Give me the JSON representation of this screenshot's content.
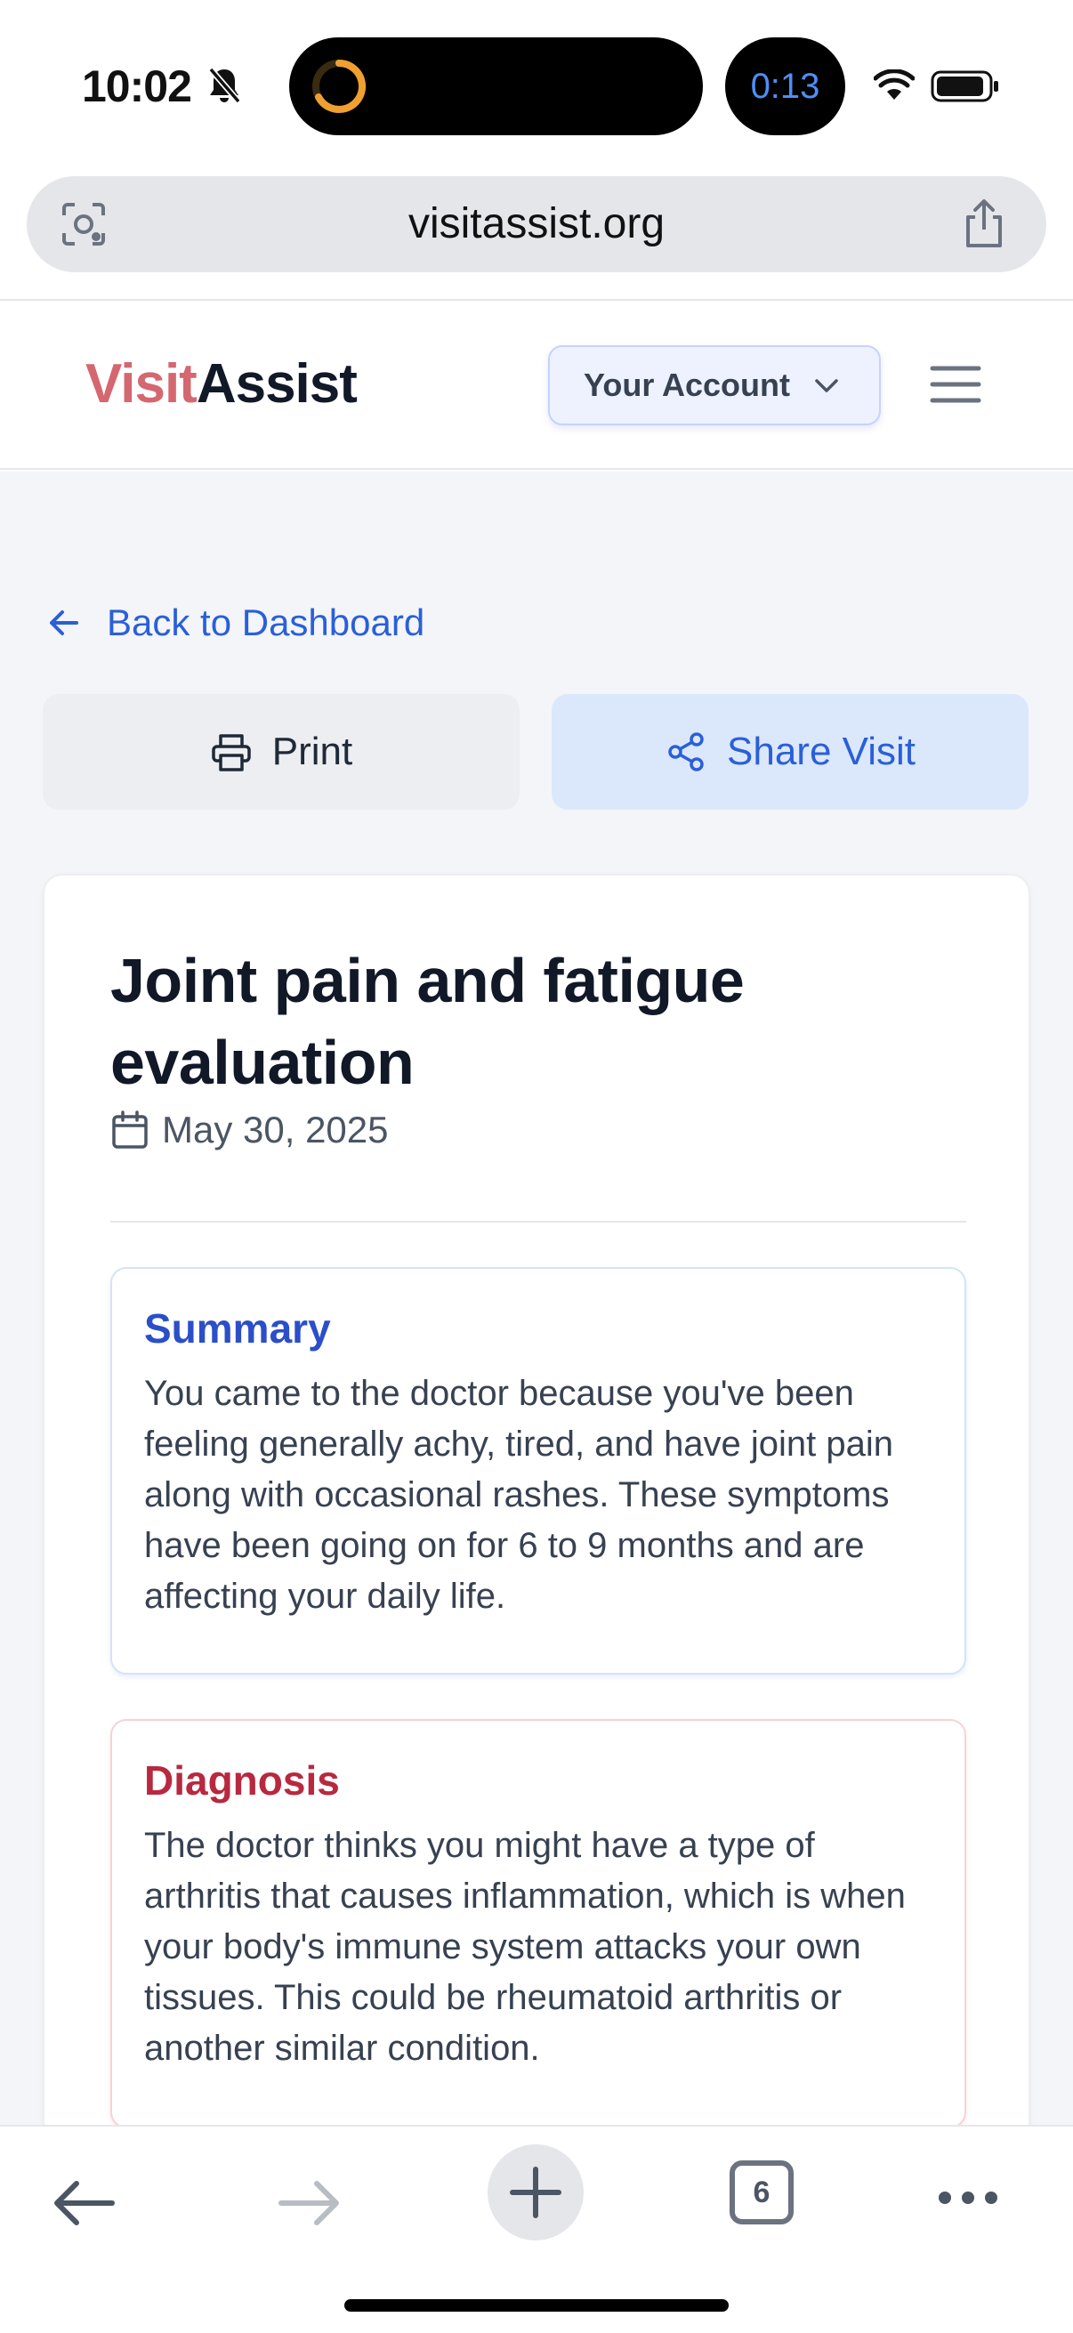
{
  "status_bar": {
    "time": "10:02",
    "timer": "0:13"
  },
  "browser": {
    "url": "visitassist.org",
    "open_tabs": "6"
  },
  "header": {
    "logo_part1": "Visit",
    "logo_part2": "Assist",
    "account_label": "Your Account"
  },
  "nav": {
    "back_label": "Back to Dashboard",
    "print_label": "Print",
    "share_label": "Share Visit"
  },
  "visit": {
    "title": "Joint pain and fatigue evaluation",
    "date": "May 30, 2025",
    "summary_heading": "Summary",
    "summary_text": "You came to the doctor because you've been feeling generally achy, tired, and have joint pain along with occasional rashes. These symptoms have been going on for 6 to 9 months and are affecting your daily life.",
    "diagnosis_heading": "Diagnosis",
    "diagnosis_text": "The doctor thinks you might have a type of arthritis that causes inflammation, which is when your body's immune system attacks your own tissues. This could be rheumatoid arthritis or another similar condition."
  },
  "colors": {
    "brand_red": "#d4676f",
    "link_blue": "#2b5fd9",
    "summary_blue": "#2b4fc9",
    "diagnosis_red": "#b8283f",
    "timer_blue": "#4f8ef7"
  },
  "icons": [
    "bell-slash-icon",
    "activity-ring-icon",
    "wifi-icon",
    "battery-icon",
    "visual-search-icon",
    "share-icon",
    "chevron-down-icon",
    "hamburger-menu-icon",
    "arrow-left-icon",
    "printer-icon",
    "share-nodes-icon",
    "calendar-icon",
    "back-arrow-icon",
    "forward-arrow-icon",
    "plus-icon",
    "tabs-icon",
    "more-icon"
  ]
}
